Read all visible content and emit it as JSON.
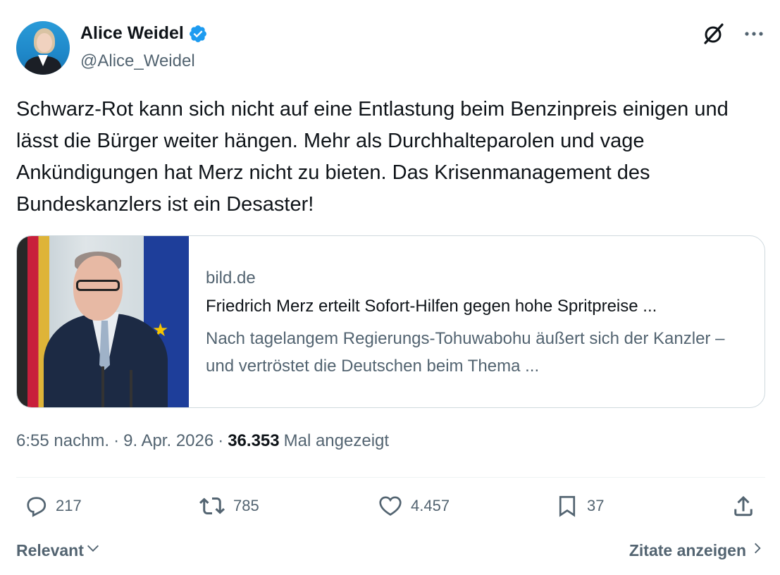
{
  "author": {
    "name": "Alice Weidel",
    "handle": "@Alice_Weidel",
    "verified": true,
    "verified_color": "#1d9bf0"
  },
  "top_icons": [
    "grok-icon",
    "more-icon"
  ],
  "tweet": {
    "text": "Schwarz-Rot kann sich nicht auf eine Entlastung beim Benzinpreis einigen und lässt die Bürger weiter hängen. Mehr als Durchhalteparolen und vage Ankündigungen hat Merz nicht zu bieten. Das Krisenmanagement des Bundeskanzlers ist ein Desaster!"
  },
  "link_card": {
    "domain": "bild.de",
    "title": "Friedrich Merz erteilt Sofort-Hilfen gegen hohe Spritpreise ...",
    "description": "Nach tagelangem Regierungs-Tohuwabohu äußert sich der Kanzler – und vertröstet die Deutschen beim Thema ..."
  },
  "meta": {
    "time": "6:55 nachm.",
    "sep1": "·",
    "date": "9. Apr. 2026",
    "sep2": "·",
    "views": "36.353",
    "views_label": "Mal angezeigt"
  },
  "actions": {
    "replies": "217",
    "reposts": "785",
    "likes": "4.457",
    "bookmarks": "37"
  },
  "footer": {
    "sort_label": "Relevant",
    "quotes_label": "Zitate anzeigen"
  },
  "colors": {
    "text_primary": "#0f1419",
    "text_secondary": "#536471",
    "border": "#cfd9de",
    "accent": "#1d9bf0"
  }
}
